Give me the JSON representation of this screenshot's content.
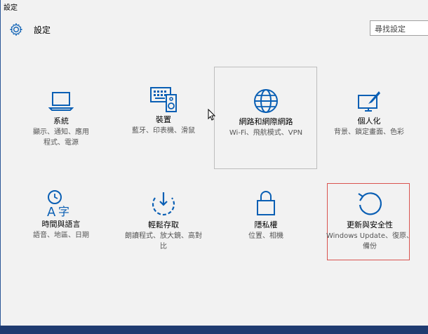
{
  "window": {
    "title": "設定"
  },
  "header": {
    "title": "設定",
    "icon": "gear-icon"
  },
  "search": {
    "placeholder": "尋找設定"
  },
  "tiles": [
    {
      "label": "系統",
      "desc": "顯示、通知、應用程式、電源",
      "icon": "laptop-icon"
    },
    {
      "label": "裝置",
      "desc": "藍牙、印表機、滑鼠",
      "icon": "keyboard-speaker-icon"
    },
    {
      "label": "網路和網際網路",
      "desc": "Wi-Fi、飛航模式、VPN",
      "icon": "globe-icon"
    },
    {
      "label": "個人化",
      "desc": "背景、鎖定畫面、色彩",
      "icon": "paint-brush-icon"
    },
    {
      "label": "時間與語言",
      "desc": "語音、地區、日期",
      "icon": "time-language-icon"
    },
    {
      "label": "輕鬆存取",
      "desc": "朗讀程式、放大鏡、高對比",
      "icon": "ease-of-access-icon"
    },
    {
      "label": "隱私權",
      "desc": "位置、相機",
      "icon": "lock-icon"
    },
    {
      "label": "更新與安全性",
      "desc": "Windows Update、復原、備份",
      "icon": "refresh-icon"
    }
  ],
  "colors": {
    "accent": "#0a5fb4",
    "background": "#f2f2f2",
    "selection_border": "#d9534f"
  }
}
